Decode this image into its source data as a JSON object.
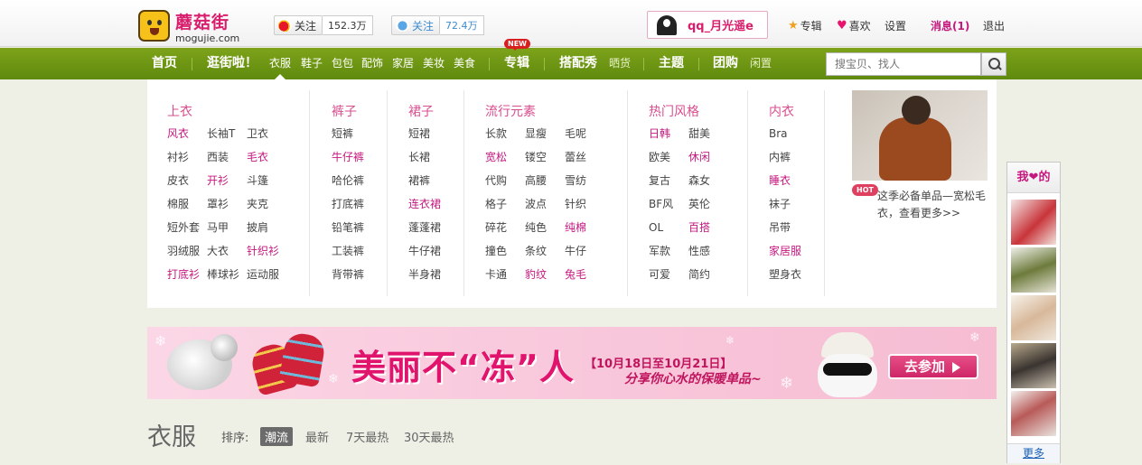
{
  "brand": {
    "name_cn": "蘑菇街",
    "name_en": "mogujie.com"
  },
  "social": {
    "weibo": {
      "label": "关注",
      "count": "152.3万"
    },
    "qq": {
      "label": "关注",
      "count": "72.4万"
    }
  },
  "user": {
    "name": "qq_月光遥e"
  },
  "top_links": {
    "zhuanji": "专辑",
    "xihuan": "喜欢",
    "shezhi": "设置",
    "messages": "消息(1)",
    "logout": "退出"
  },
  "nav": {
    "home": "首页",
    "stroll": "逛街啦！",
    "clothes": "衣服",
    "shoes": "鞋子",
    "bags": "包包",
    "accessories": "配饰",
    "home_living": "家居",
    "beauty": "美妆",
    "food": "美食",
    "albums": "专辑",
    "new_badge": "NEW",
    "outfits": "搭配秀",
    "show_items": "晒货",
    "themes": "主题",
    "group_buy": "团购",
    "idle": "闲置"
  },
  "search": {
    "placeholder": "搜宝贝、找人"
  },
  "menu": {
    "tops": {
      "title": "上衣",
      "items": [
        "风衣",
        "长袖T",
        "卫衣",
        "衬衫",
        "西装",
        "毛衣",
        "皮衣",
        "开衫",
        "斗篷",
        "棉服",
        "罩衫",
        "夹克",
        "短外套",
        "马甲",
        "披肩",
        "羽绒服",
        "大衣",
        "针织衫",
        "打底衫",
        "棒球衫",
        "运动服"
      ]
    },
    "pants": {
      "title": "裤子",
      "items": [
        "短裤",
        "牛仔裤",
        "哈伦裤",
        "打底裤",
        "铅笔裤",
        "工装裤",
        "背带裤"
      ]
    },
    "skirts": {
      "title": "裙子",
      "items": [
        "短裙",
        "长裙",
        "裙裤",
        "连衣裙",
        "蓬蓬裙",
        "牛仔裙",
        "半身裙"
      ]
    },
    "trends": {
      "title": "流行元素",
      "items": [
        "长款",
        "显瘦",
        "毛呢",
        "宽松",
        "镂空",
        "蕾丝",
        "代购",
        "高腰",
        "雪纺",
        "格子",
        "波点",
        "针织",
        "碎花",
        "纯色",
        "纯棉",
        "撞色",
        "条纹",
        "牛仔",
        "卡通",
        "豹纹",
        "兔毛"
      ]
    },
    "styles": {
      "title": "热门风格",
      "items": [
        "日韩",
        "甜美",
        "欧美",
        "休闲",
        "复古",
        "森女",
        "BF风",
        "英伦",
        "OL",
        "百搭",
        "军款",
        "性感",
        "可爱",
        "简约"
      ]
    },
    "underwear": {
      "title": "内衣",
      "items": [
        "Bra",
        "内裤",
        "睡衣",
        "袜子",
        "吊带",
        "家居服",
        "塑身衣"
      ]
    }
  },
  "promo": {
    "badge": "HOT",
    "text": "这季必备单品—宽松毛衣，查看更多>>"
  },
  "banner": {
    "headline": "美丽不“冻”人",
    "dates": "【10月18日至10月21日】",
    "tagline": "分享你心水的保暖单品~",
    "cta": "去参加"
  },
  "section": {
    "title": "衣服",
    "sort_label": "排序:",
    "sort_options": [
      "潮流",
      "最新",
      "7天最热",
      "30天最热"
    ]
  },
  "sidebar": {
    "title": "我❤的",
    "more": "更多"
  },
  "colors": {
    "brand_pink": "#d81e6d",
    "nav_green": "#6f9916",
    "hot_pink": "#c5187f"
  }
}
